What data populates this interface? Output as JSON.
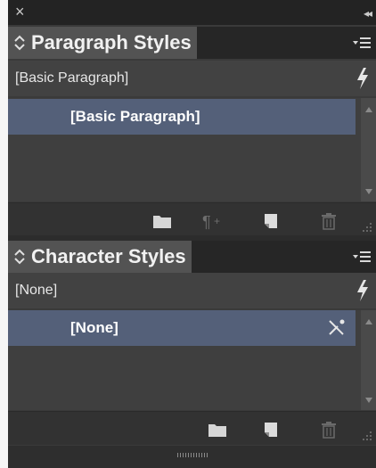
{
  "paragraph_panel": {
    "title": "Paragraph Styles",
    "current_style": "[Basic Paragraph]",
    "items": [
      {
        "label": "[Basic Paragraph]"
      }
    ],
    "footer_buttons": [
      "folder-icon",
      "clear-overrides-icon",
      "new-style-icon",
      "trash-icon"
    ]
  },
  "character_panel": {
    "title": "Character Styles",
    "current_style": "[None]",
    "items": [
      {
        "label": "[None]"
      }
    ],
    "footer_buttons": [
      "folder-icon",
      "new-style-icon",
      "trash-icon"
    ]
  },
  "colors": {
    "panel_bg": "#3a3a3a",
    "tab_active": "#535353",
    "selection": "#546079",
    "text": "#f1f1f1"
  }
}
